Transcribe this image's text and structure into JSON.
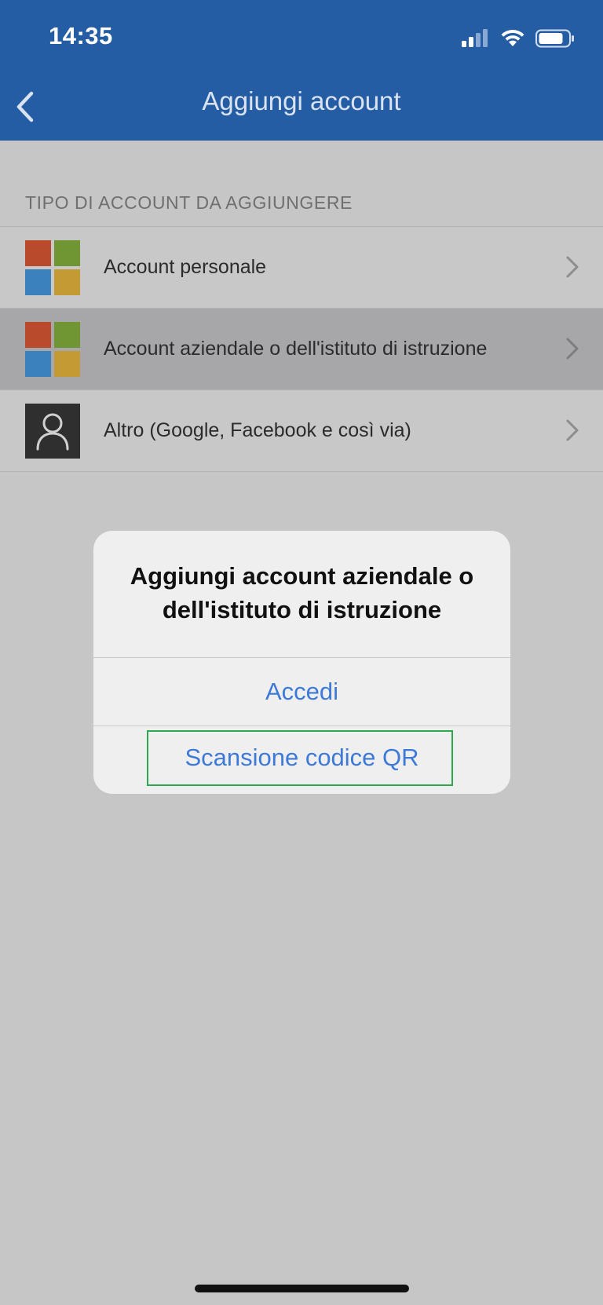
{
  "status_bar": {
    "time": "14:35",
    "icons": [
      "cellular-signal-icon",
      "wifi-icon",
      "battery-icon"
    ]
  },
  "nav_bar": {
    "back_icon": "chevron-left-icon",
    "title": "Aggiungi account"
  },
  "section": {
    "header": "TIPO DI ACCOUNT DA AGGIUNGERE"
  },
  "accounts": [
    {
      "label": "Account personale",
      "icon": "microsoft-logo-icon",
      "highlighted": false
    },
    {
      "label": "Account aziendale o dell'istituto di istruzione",
      "icon": "microsoft-logo-icon",
      "highlighted": true
    },
    {
      "label": "Altro (Google, Facebook e così via)",
      "icon": "person-icon",
      "highlighted": false
    }
  ],
  "alert": {
    "title": "Aggiungi account aziendale o dell'istituto di istruzione",
    "buttons": [
      "Accedi",
      "Scansione codice QR"
    ],
    "highlighted_button": "Scansione codice QR"
  },
  "colors": {
    "nav_background": "#245da3",
    "overlay_background": "#c6c6c6",
    "alert_button_text": "#3d7ad8",
    "highlight_frame": "#2ea84d",
    "ms_red": "#b94a2c",
    "ms_green": "#6f9633",
    "ms_blue": "#3b81bd",
    "ms_yellow": "#c49a35"
  }
}
